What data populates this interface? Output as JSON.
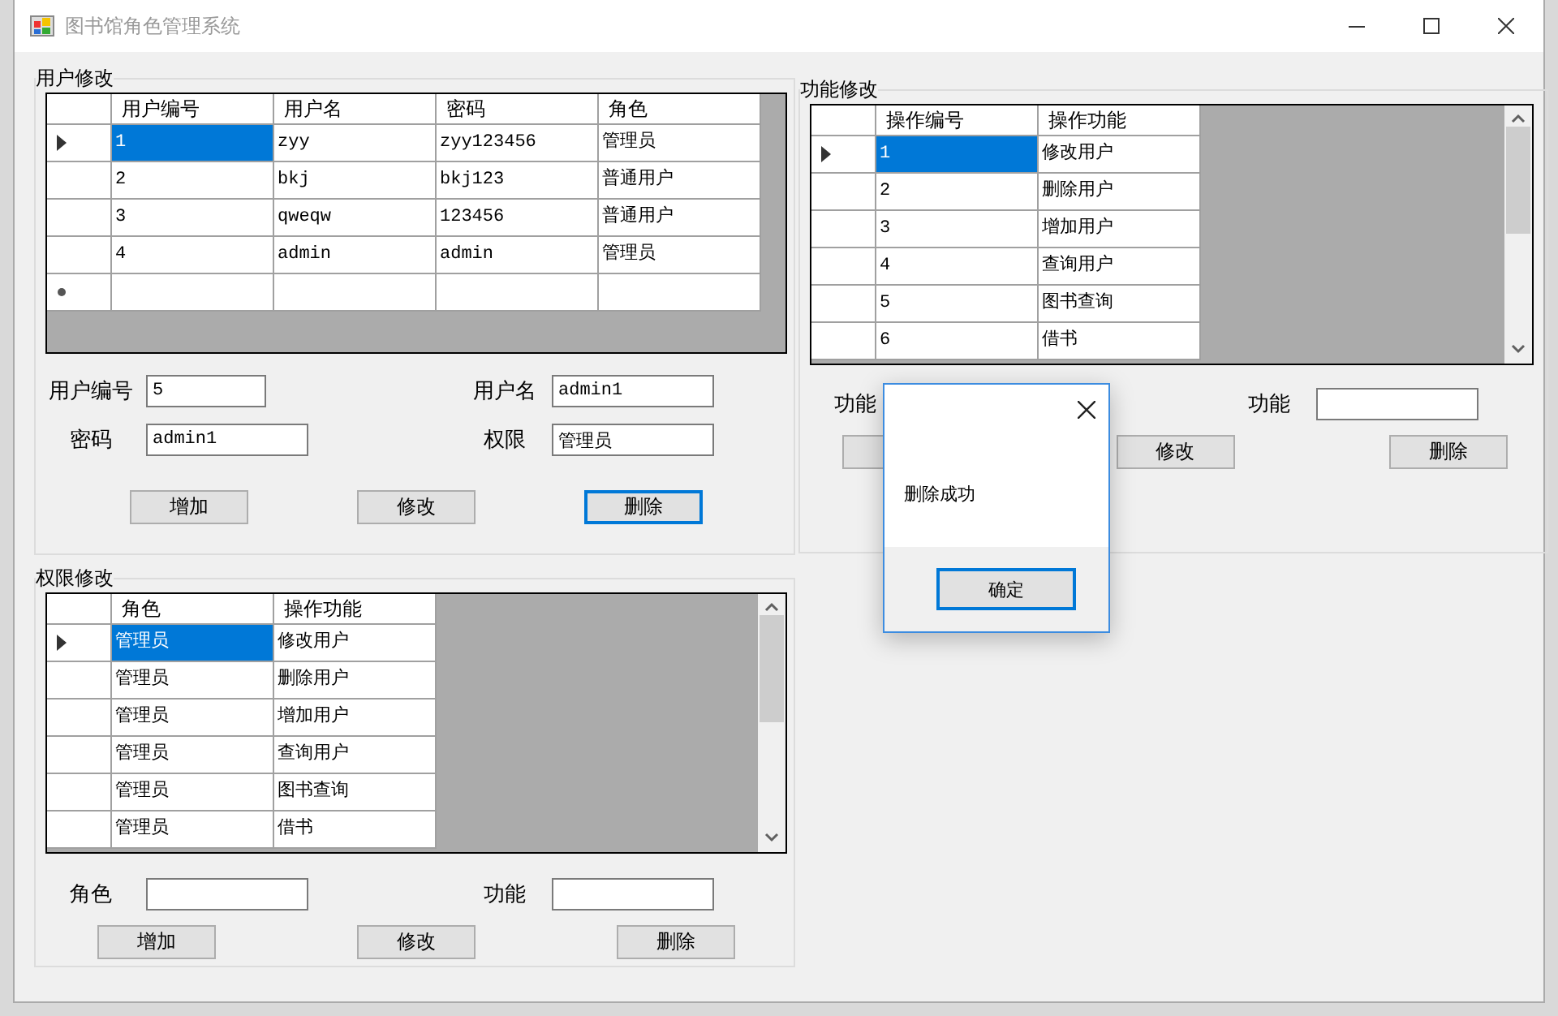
{
  "window": {
    "title": "图书馆角色管理系统"
  },
  "user_panel": {
    "title": "用户修改",
    "table": {
      "columns": [
        "用户编号",
        "用户名",
        "密码",
        "角色"
      ],
      "new_row": true,
      "rows": [
        {
          "cells": [
            "1",
            "zyy",
            "zyy123456",
            "管理员"
          ],
          "selected": true
        },
        {
          "cells": [
            "2",
            "bkj",
            "bkj123",
            "普通用户"
          ],
          "selected": false
        },
        {
          "cells": [
            "3",
            "qweqw",
            "123456",
            "普通用户"
          ],
          "selected": false
        },
        {
          "cells": [
            "4",
            "admin",
            "admin",
            "管理员"
          ],
          "selected": false
        }
      ]
    },
    "fields": [
      {
        "label": "用户编号",
        "value": "5"
      },
      {
        "label": "用户名",
        "value": "admin1"
      },
      {
        "label": "密码",
        "value": "admin1"
      },
      {
        "label": "权限",
        "value": "管理员"
      }
    ],
    "buttons": [
      {
        "label": "增加",
        "focused": false
      },
      {
        "label": "修改",
        "focused": false
      },
      {
        "label": "删除",
        "focused": true
      }
    ]
  },
  "function_panel": {
    "title": "功能修改",
    "table": {
      "columns": [
        "操作编号",
        "操作功能"
      ],
      "rows": [
        {
          "cells": [
            "1",
            "修改用户"
          ],
          "selected": true
        },
        {
          "cells": [
            "2",
            "删除用户"
          ],
          "selected": false
        },
        {
          "cells": [
            "3",
            "增加用户"
          ],
          "selected": false
        },
        {
          "cells": [
            "4",
            "查询用户"
          ],
          "selected": false
        },
        {
          "cells": [
            "5",
            "图书查询"
          ],
          "selected": false
        },
        {
          "cells": [
            "6",
            "借书"
          ],
          "selected": false
        }
      ]
    },
    "fields": [
      {
        "kind": "label",
        "label": "功能"
      },
      {
        "kind": "field",
        "label": "功能"
      }
    ],
    "buttons": [
      {
        "focused": false
      },
      {
        "label": "修改",
        "focused": false
      },
      {
        "label": "删除",
        "focused": false
      }
    ]
  },
  "permission_panel": {
    "title": "权限修改",
    "table": {
      "columns": [
        "角色",
        "操作功能"
      ],
      "rows": [
        {
          "cells": [
            "管理员",
            "修改用户"
          ],
          "selected": true
        },
        {
          "cells": [
            "管理员",
            "删除用户"
          ],
          "selected": false
        },
        {
          "cells": [
            "管理员",
            "增加用户"
          ],
          "selected": false
        },
        {
          "cells": [
            "管理员",
            "查询用户"
          ],
          "selected": false
        },
        {
          "cells": [
            "管理员",
            "图书查询"
          ],
          "selected": false
        },
        {
          "cells": [
            "管理员",
            "借书"
          ],
          "selected": false
        }
      ]
    },
    "fields": [
      {
        "label": "角色"
      },
      {
        "label": "功能"
      }
    ],
    "buttons": [
      {
        "label": "增加",
        "focused": false
      },
      {
        "label": "修改",
        "focused": false
      },
      {
        "label": "删除",
        "focused": false
      }
    ]
  },
  "dialog": {
    "message": "删除成功",
    "button": "确定"
  }
}
